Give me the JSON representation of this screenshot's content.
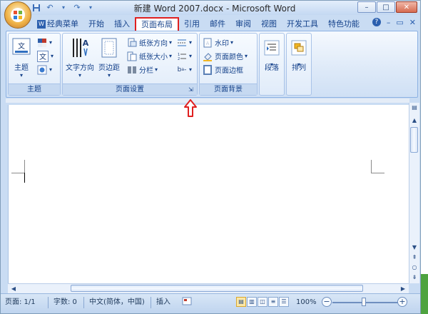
{
  "window": {
    "title": "新建 Word 2007.docx - Microsoft Word"
  },
  "quick_access": {
    "save_icon": "save-icon",
    "undo_icon": "undo-icon",
    "redo_icon": "redo-icon",
    "customize_icon": "customize-qat-icon"
  },
  "window_buttons": {
    "minimize": "–",
    "maximize": "□",
    "close": "✕"
  },
  "tabs": [
    {
      "label": "经典菜单"
    },
    {
      "label": "开始"
    },
    {
      "label": "插入"
    },
    {
      "label": "页面布局",
      "active": true
    },
    {
      "label": "引用"
    },
    {
      "label": "邮件"
    },
    {
      "label": "审阅"
    },
    {
      "label": "视图"
    },
    {
      "label": "开发工具"
    },
    {
      "label": "特色功能"
    }
  ],
  "tab_right": {
    "help": "?",
    "min": "–",
    "restore": "▭",
    "close": "✕"
  },
  "ribbon": {
    "theme_group": {
      "label": "主题",
      "theme_button": "主题",
      "colors_icon": "theme-colors-icon",
      "fonts_icon": "theme-fonts-icon",
      "effects_icon": "theme-effects-icon",
      "fonts_glyph": "文"
    },
    "page_setup_group": {
      "label": "页面设置",
      "text_direction": "文字方向",
      "margins": "页边距",
      "orientation": "纸张方向",
      "size": "纸张大小",
      "columns": "分栏"
    },
    "page_background_group": {
      "label": "页面背景",
      "watermark": "水印",
      "page_color": "页面颜色",
      "page_borders": "页面边框"
    },
    "paragraph_group": {
      "label": "段落"
    },
    "arrange_group": {
      "label": "排列"
    }
  },
  "document": {
    "text_box_glyph": "文"
  },
  "status_bar": {
    "page": "页面: 1/1",
    "words": "字数: 0",
    "language": "中文(简体，中国)",
    "mode": "插入",
    "zoom": "100%",
    "zoom_out": "−",
    "zoom_in": "+"
  },
  "colors": {
    "active_tab_border": "#e02020",
    "annotation_arrow": "#e02020",
    "ribbon_blue": "#15428b"
  }
}
